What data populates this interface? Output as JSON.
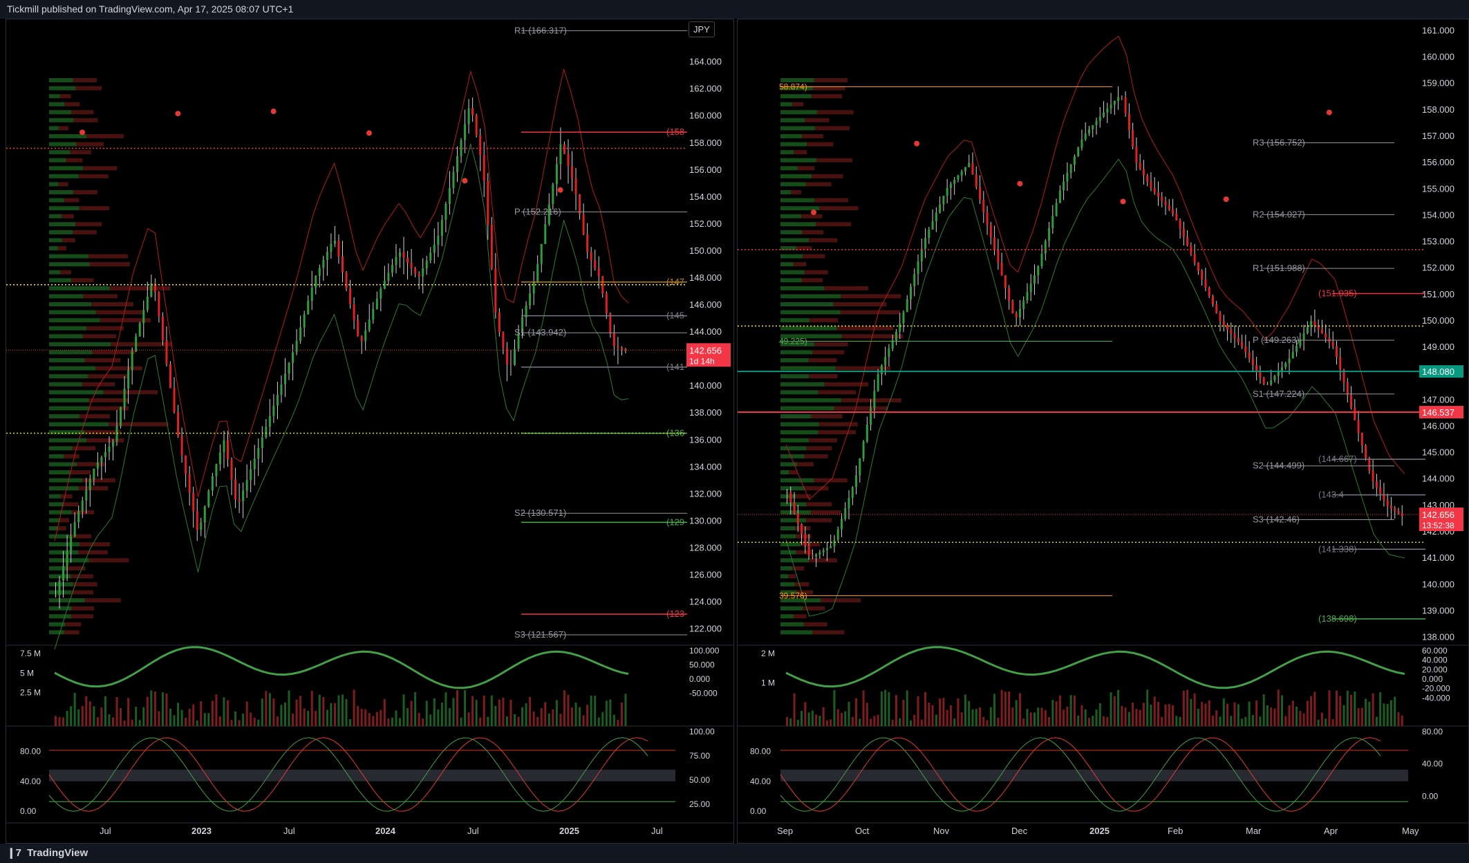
{
  "header": {
    "text": "Tickmill published on TradingView.com, Apr 17, 2025 08:07 UTC+1"
  },
  "footer": {
    "brand": "TradingView",
    "logo_icon": "tradingview-logo-icon"
  },
  "colors": {
    "up": "#26a69a",
    "green_candle": "#2e9e3a",
    "red_candle": "#e0211d",
    "price_badge": "#f23645",
    "bg": "#000000",
    "grid": "#1e222d",
    "text": "#d1d4dc"
  },
  "chart_data": [
    {
      "type": "candlestick",
      "symbol_badge": "JPY",
      "price_axis_ticks": [
        "164.000",
        "162.000",
        "160.000",
        "158.000",
        "156.000",
        "154.000",
        "152.000",
        "150.000",
        "148.000",
        "146.000",
        "144.000",
        "142.000",
        "140.000",
        "138.000",
        "136.000",
        "134.000",
        "132.000",
        "130.000",
        "128.000",
        "126.000",
        "124.000",
        "122.000"
      ],
      "ylim": [
        120.8,
        166.9
      ],
      "time_axis_labels": [
        "Jul",
        "2023",
        "Jul",
        "2024",
        "Jul",
        "2025",
        "Jul"
      ],
      "last_price": "142.656",
      "countdown": "1d 14h",
      "pivots": [
        {
          "label": "R1 (166.317)",
          "value": 166.317
        },
        {
          "label": "P (152.216)",
          "value": 152.9
        },
        {
          "label": "S1 (143.942)",
          "value": 143.942
        },
        {
          "label": "S2 (130.571)",
          "value": 130.571
        },
        {
          "label": "S3 (121.567)",
          "value": 121.567
        }
      ],
      "right_levels": [
        {
          "label": "(158",
          "value": 158.8,
          "color": "#f23645"
        },
        {
          "label": "(147",
          "value": 147.7,
          "color": "#b8860b"
        },
        {
          "label": "(145",
          "value": 145.2,
          "color": "#787b86"
        },
        {
          "label": "(141",
          "value": 141.4,
          "color": "#787b86"
        },
        {
          "label": "(136",
          "value": 136.5,
          "color": "#4caf50"
        },
        {
          "label": "(129",
          "value": 129.9,
          "color": "#4caf50"
        },
        {
          "label": "(123",
          "value": 123.1,
          "color": "#f23645"
        }
      ],
      "price_path": [
        [
          0,
          124.5
        ],
        [
          0.03,
          130
        ],
        [
          0.06,
          134
        ],
        [
          0.09,
          136
        ],
        [
          0.12,
          143
        ],
        [
          0.15,
          148
        ],
        [
          0.17,
          142
        ],
        [
          0.19,
          136
        ],
        [
          0.22,
          129
        ],
        [
          0.24,
          133
        ],
        [
          0.26,
          136
        ],
        [
          0.28,
          131
        ],
        [
          0.31,
          135
        ],
        [
          0.34,
          139
        ],
        [
          0.37,
          143
        ],
        [
          0.4,
          148
        ],
        [
          0.43,
          151
        ],
        [
          0.45,
          147
        ],
        [
          0.47,
          143
        ],
        [
          0.5,
          147
        ],
        [
          0.53,
          150
        ],
        [
          0.56,
          148
        ],
        [
          0.59,
          151
        ],
        [
          0.62,
          157
        ],
        [
          0.64,
          161
        ],
        [
          0.66,
          156
        ],
        [
          0.68,
          145
        ],
        [
          0.7,
          141
        ],
        [
          0.72,
          145
        ],
        [
          0.74,
          148
        ],
        [
          0.76,
          153
        ],
        [
          0.78,
          158
        ],
        [
          0.8,
          155
        ],
        [
          0.82,
          150
        ],
        [
          0.84,
          148
        ],
        [
          0.86,
          143
        ],
        [
          0.88,
          142.6
        ]
      ],
      "volume_axis": [
        "7.5 M",
        "5 M",
        "2.5 M"
      ],
      "volume_osc_axis": [
        "100.000",
        "50.000",
        "0.000",
        "-50.000"
      ],
      "stoch_left_axis": [
        "80.00",
        "40.00",
        "0.00"
      ],
      "stoch_right_axis": [
        "100.00",
        "75.00",
        "50.00",
        "25.00"
      ]
    },
    {
      "type": "candlestick",
      "price_axis_ticks": [
        "161.000",
        "160.000",
        "159.000",
        "158.000",
        "157.000",
        "156.000",
        "155.000",
        "154.000",
        "153.000",
        "152.000",
        "151.000",
        "150.000",
        "149.000",
        "148.000",
        "147.000",
        "146.000",
        "145.000",
        "144.000",
        "143.000",
        "142.000",
        "141.000",
        "140.000",
        "139.000",
        "138.000"
      ],
      "ylim": [
        137.7,
        161.3
      ],
      "time_axis_labels": [
        "Sep",
        "Oct",
        "Nov",
        "Dec",
        "2025",
        "Feb",
        "Mar",
        "Apr",
        "May"
      ],
      "last_price": "142.656",
      "countdown": "13:52:38",
      "badges": [
        {
          "label": "148.080",
          "value": 148.08,
          "color": "#089981"
        },
        {
          "label": "146.537",
          "value": 146.537,
          "color": "#f23645"
        }
      ],
      "pivots": [
        {
          "label": "R3 (156.752)",
          "value": 156.752
        },
        {
          "label": "R2 (154.027)",
          "value": 154.027
        },
        {
          "label": "R1 (151.988)",
          "value": 151.988
        },
        {
          "label": "P (149.263)",
          "value": 149.263
        },
        {
          "label": "S1 (147.224)",
          "value": 147.224
        },
        {
          "label": "S2 (144.499)",
          "value": 144.499
        },
        {
          "label": "S3 (142.46)",
          "value": 142.46
        }
      ],
      "levels": [
        {
          "label": "(151.035)",
          "value": 151.035,
          "color": "#f23645"
        },
        {
          "label": "(144.667)",
          "value": 144.75,
          "color": "#787b86"
        },
        {
          "label": "(143.4",
          "value": 143.4,
          "color": "#787b86"
        },
        {
          "label": "(141.338)",
          "value": 141.338,
          "color": "#787b86"
        },
        {
          "label": "(138.698)",
          "value": 138.698,
          "color": "#4caf50"
        }
      ],
      "left_labels": [
        {
          "label": "58.874)",
          "value": 158.874,
          "color": "#ff9800"
        },
        {
          "label": "39.576)",
          "value": 139.576,
          "color": "#ff9800"
        },
        {
          "label": "49.225)",
          "value": 149.225,
          "color": "#4caf50"
        }
      ],
      "price_path": [
        [
          0,
          143.5
        ],
        [
          0.03,
          141
        ],
        [
          0.06,
          141.5
        ],
        [
          0.09,
          144
        ],
        [
          0.12,
          148
        ],
        [
          0.15,
          150
        ],
        [
          0.18,
          153
        ],
        [
          0.21,
          155
        ],
        [
          0.24,
          156
        ],
        [
          0.27,
          153
        ],
        [
          0.3,
          150
        ],
        [
          0.33,
          152
        ],
        [
          0.36,
          155
        ],
        [
          0.39,
          157
        ],
        [
          0.42,
          158
        ],
        [
          0.44,
          158.6
        ],
        [
          0.46,
          156
        ],
        [
          0.48,
          155
        ],
        [
          0.51,
          154
        ],
        [
          0.54,
          152
        ],
        [
          0.57,
          150
        ],
        [
          0.6,
          149
        ],
        [
          0.63,
          147.5
        ],
        [
          0.66,
          148.5
        ],
        [
          0.69,
          150
        ],
        [
          0.72,
          149
        ],
        [
          0.75,
          146
        ],
        [
          0.77,
          144
        ],
        [
          0.79,
          143
        ],
        [
          0.81,
          142.6
        ]
      ],
      "volume_axis": [
        "2 M",
        "1 M"
      ],
      "volume_osc_axis": [
        "60.000",
        "40.000",
        "20.000",
        "0.000",
        "-20.000",
        "-40.000"
      ],
      "stoch_left_axis": [
        "80.00",
        "40.00",
        "0.00"
      ],
      "stoch_right_axis": [
        "80.00",
        "40.00",
        "0.00"
      ]
    }
  ]
}
